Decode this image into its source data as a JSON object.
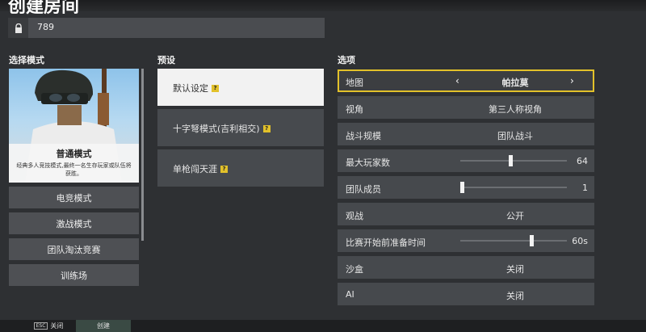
{
  "header": {
    "title": "创建房间"
  },
  "password": {
    "value": "789"
  },
  "mode_panel": {
    "heading": "选择模式",
    "featured": {
      "name": "普通模式",
      "description": "经典多人竞技模式,最终一名生存玩家或队伍将获胜。"
    },
    "buttons": [
      "电竞模式",
      "激战模式",
      "团队淘汰竞赛",
      "训练场"
    ]
  },
  "preset_panel": {
    "heading": "预设",
    "items": [
      {
        "label": "默认设定",
        "help": "?"
      },
      {
        "label": "十字弩模式(吉利相交)",
        "help": "?"
      },
      {
        "label": "单枪闯天涯",
        "help": "?"
      }
    ]
  },
  "options_panel": {
    "heading": "选项",
    "map": {
      "label": "地图",
      "value": "帕拉莫"
    },
    "view": {
      "label": "视角",
      "value": "第三人称视角"
    },
    "scale": {
      "label": "战斗规模",
      "value": "团队战斗"
    },
    "max_players": {
      "label": "最大玩家数",
      "value": "64",
      "fraction": 0.47
    },
    "team_members": {
      "label": "团队成员",
      "value": "1",
      "fraction": 0.0
    },
    "spectate": {
      "label": "观战",
      "value": "公开"
    },
    "prep_time": {
      "label": "比赛开始前准备时间",
      "value": "60s",
      "fraction": 0.68
    },
    "sandbox": {
      "label": "沙盒",
      "value": "关闭"
    },
    "ai": {
      "label": "AI",
      "value": "关闭"
    }
  },
  "footer": {
    "close_key": "ESC",
    "close_label": "关闭",
    "create_label": "创建"
  },
  "colors": {
    "accent": "#e2c12a",
    "background": "#2e3033",
    "row": "#46494d"
  }
}
